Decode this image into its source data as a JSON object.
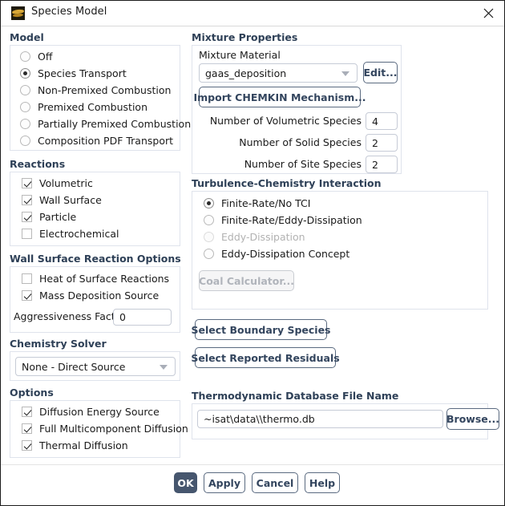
{
  "window": {
    "title": "Species Model",
    "icon": "fluent-logo-icon",
    "close_label": "✕"
  },
  "model": {
    "header": "Model",
    "options": [
      {
        "label": "Off",
        "selected": false
      },
      {
        "label": "Species Transport",
        "selected": true
      },
      {
        "label": "Non-Premixed Combustion",
        "selected": false
      },
      {
        "label": "Premixed Combustion",
        "selected": false
      },
      {
        "label": "Partially Premixed Combustion",
        "selected": false
      },
      {
        "label": "Composition PDF Transport",
        "selected": false
      }
    ]
  },
  "reactions": {
    "header": "Reactions",
    "options": [
      {
        "label": "Volumetric",
        "checked": true
      },
      {
        "label": "Wall Surface",
        "checked": true
      },
      {
        "label": "Particle",
        "checked": true
      },
      {
        "label": "Electrochemical",
        "checked": false
      }
    ]
  },
  "wall_surface_reaction_options": {
    "header": "Wall Surface Reaction Options",
    "options": [
      {
        "label": "Heat of Surface Reactions",
        "checked": false
      },
      {
        "label": "Mass Deposition Source",
        "checked": true
      }
    ],
    "aggressiveness_factor": {
      "label": "Aggressiveness Factor",
      "value": "0"
    }
  },
  "chemistry_solver": {
    "header": "Chemistry Solver",
    "selected": "None - Direct Source"
  },
  "options": {
    "header": "Options",
    "items": [
      {
        "label": "Diffusion Energy Source",
        "checked": true
      },
      {
        "label": "Full Multicomponent Diffusion",
        "checked": true
      },
      {
        "label": "Thermal Diffusion",
        "checked": true
      }
    ]
  },
  "mixture_properties": {
    "header": "Mixture Properties",
    "material_label": "Mixture Material",
    "material_value": "gaas_deposition",
    "edit_button": "Edit...",
    "import_button": "Import CHEMKIN Mechanism...",
    "species_counts": [
      {
        "label": "Number of Volumetric Species",
        "value": "4"
      },
      {
        "label": "Number of Solid Species",
        "value": "2"
      },
      {
        "label": "Number of Site Species",
        "value": "2"
      }
    ]
  },
  "turbulence_chemistry": {
    "header": "Turbulence-Chemistry Interaction",
    "options": [
      {
        "label": "Finite-Rate/No TCI",
        "selected": true,
        "disabled": false
      },
      {
        "label": "Finite-Rate/Eddy-Dissipation",
        "selected": false,
        "disabled": false
      },
      {
        "label": "Eddy-Dissipation",
        "selected": false,
        "disabled": true
      },
      {
        "label": "Eddy-Dissipation Concept",
        "selected": false,
        "disabled": false
      }
    ],
    "coal_calculator_button": "Coal Calculator...",
    "coal_calculator_disabled": true
  },
  "actions": {
    "select_boundary_species": "Select Boundary Species",
    "select_reported_residuals": "Select Reported Residuals"
  },
  "thermodynamic_db": {
    "header": "Thermodynamic Database File Name",
    "value": "~isat\\data\\\\thermo.db",
    "browse_button": "Browse..."
  },
  "footer": {
    "ok": "OK",
    "apply": "Apply",
    "cancel": "Cancel",
    "help": "Help"
  },
  "colors": {
    "header_text": "#2e4057",
    "button_text": "#33455e",
    "primary_button_bg": "#46566e",
    "group_border": "#dfe3ec"
  }
}
